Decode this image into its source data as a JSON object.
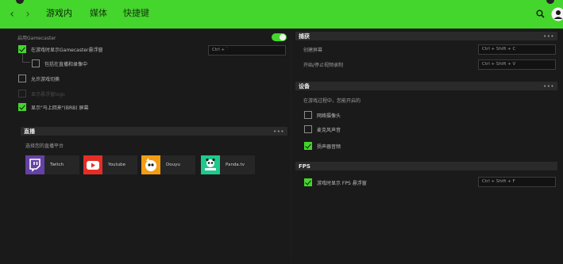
{
  "nav": {
    "back": "‹",
    "forward": "›"
  },
  "tabs": [
    {
      "label": "游戏内",
      "active": true
    },
    {
      "label": "媒体",
      "active": false
    },
    {
      "label": "快捷键",
      "active": false
    }
  ],
  "accent": "#44d62c",
  "top_icons": [
    "search-icon",
    "user-avatar-icon"
  ],
  "left": {
    "enable_label": "启用Gamecaster",
    "enable_on": true,
    "options": [
      {
        "label": "在游戏时显示Gamecaster悬浮窗",
        "checked": true,
        "disabled": false,
        "shortcut": "Ctrl + `"
      },
      {
        "label": "包括在直播和录像中",
        "checked": false,
        "disabled": false
      },
      {
        "label": "允许游戏切换",
        "checked": false,
        "disabled": false
      },
      {
        "label": "显示悬浮窗logo",
        "checked": false,
        "disabled": true
      },
      {
        "label": "显示\"马上回来\"(BRB) 屏幕",
        "checked": true,
        "disabled": false
      }
    ],
    "live": {
      "title": "直播",
      "more": "•••",
      "subtitle": "选择您的直播平台",
      "platforms": [
        {
          "name": "Twitch",
          "icon": "twitch-icon",
          "color": "#6441a4"
        },
        {
          "name": "Youtube",
          "icon": "youtube-icon",
          "color": "#e52d27"
        },
        {
          "name": "Douyu",
          "icon": "douyu-icon",
          "color": "#f39c12"
        },
        {
          "name": "Panda.tv",
          "icon": "pandatv-icon",
          "color": "#1ec98b"
        }
      ]
    }
  },
  "right": {
    "capture": {
      "title": "捕获",
      "more": "•••",
      "rows": [
        {
          "label": "创建屏幕",
          "shortcut": "Ctrl + Shift + C"
        },
        {
          "label": "开始/停止视频录制",
          "shortcut": "Ctrl + Shift + V"
        }
      ]
    },
    "devices": {
      "title": "设备",
      "more": "•••",
      "subtitle": "在游戏过程中，您能开启的",
      "options": [
        {
          "label": "网络摄像头",
          "checked": false
        },
        {
          "label": "麦克风声音",
          "checked": false
        },
        {
          "label": "扬声器音频",
          "checked": true
        }
      ]
    },
    "fps": {
      "title": "FPS",
      "option": {
        "label": "游戏时显示 FPS 悬浮窗",
        "checked": true
      },
      "shortcut": "Ctrl + Shift + F"
    }
  }
}
